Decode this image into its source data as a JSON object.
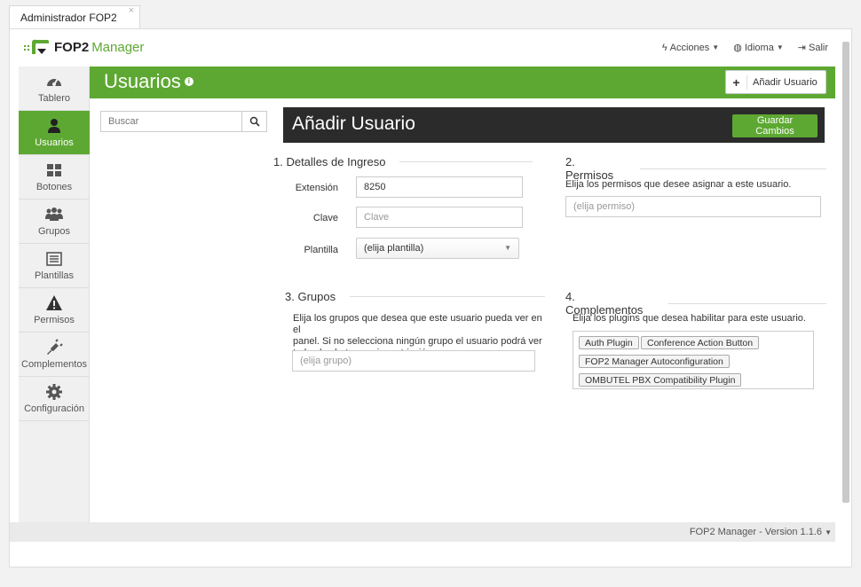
{
  "browser": {
    "tab_title": "Administrador FOP2",
    "close_glyph": "×"
  },
  "brand": {
    "name": "FOP2",
    "suffix": "Manager"
  },
  "topnav": {
    "acciones": "Acciones",
    "idioma": "Idioma",
    "salir": "Salir"
  },
  "sidebar": {
    "items": [
      {
        "label": "Tablero",
        "icon": "dashboard-icon"
      },
      {
        "label": "Usuarios",
        "icon": "user-icon",
        "active": true
      },
      {
        "label": "Botones",
        "icon": "grid-icon"
      },
      {
        "label": "Grupos",
        "icon": "group-icon"
      },
      {
        "label": "Plantillas",
        "icon": "list-icon"
      },
      {
        "label": "Permisos",
        "icon": "warning-icon"
      },
      {
        "label": "Complementos",
        "icon": "plug-icon"
      },
      {
        "label": "Configuración",
        "icon": "gear-icon"
      }
    ]
  },
  "page": {
    "title": "Usuarios",
    "add_button": "Añadir Usuario",
    "add_symbol": "+",
    "info_symbol": "i"
  },
  "search": {
    "placeholder": "Buscar"
  },
  "form": {
    "title": "Añadir Usuario",
    "save_button": "Guardar Cambios",
    "login": {
      "title": "1. Detalles de Ingreso",
      "extension_label": "Extensión",
      "extension_value": "8250",
      "password_label": "Clave",
      "password_placeholder": "Clave",
      "template_label": "Plantilla",
      "template_value": "(elija plantilla)"
    },
    "permissions": {
      "title": "2. Permisos",
      "description": "Elija los permisos que desee asignar a este usuario.",
      "placeholder": "(elija permiso)"
    },
    "groups": {
      "title": "3. Grupos",
      "description_line1": "Elija los grupos que desea que este usuario pueda ver en el",
      "description_line2": "panel. Si no selecciona ningún grupo el usuario podrá ver",
      "description_line3": "todos los botones sin restricción.",
      "placeholder": "(elija grupo)"
    },
    "plugins": {
      "title": "4. Complementos",
      "description": "Elija los plugins que desea habilitar para este usuario.",
      "chips": [
        "Auth Plugin",
        "Conference Action Button",
        "FOP2 Manager Autoconfiguration",
        "OMBUTEL PBX Compatibility Plugin"
      ]
    }
  },
  "footer": {
    "version": "FOP2 Manager - Version 1.1.6"
  },
  "colors": {
    "accent": "#5da832",
    "dark_header": "#2b2b2b"
  }
}
